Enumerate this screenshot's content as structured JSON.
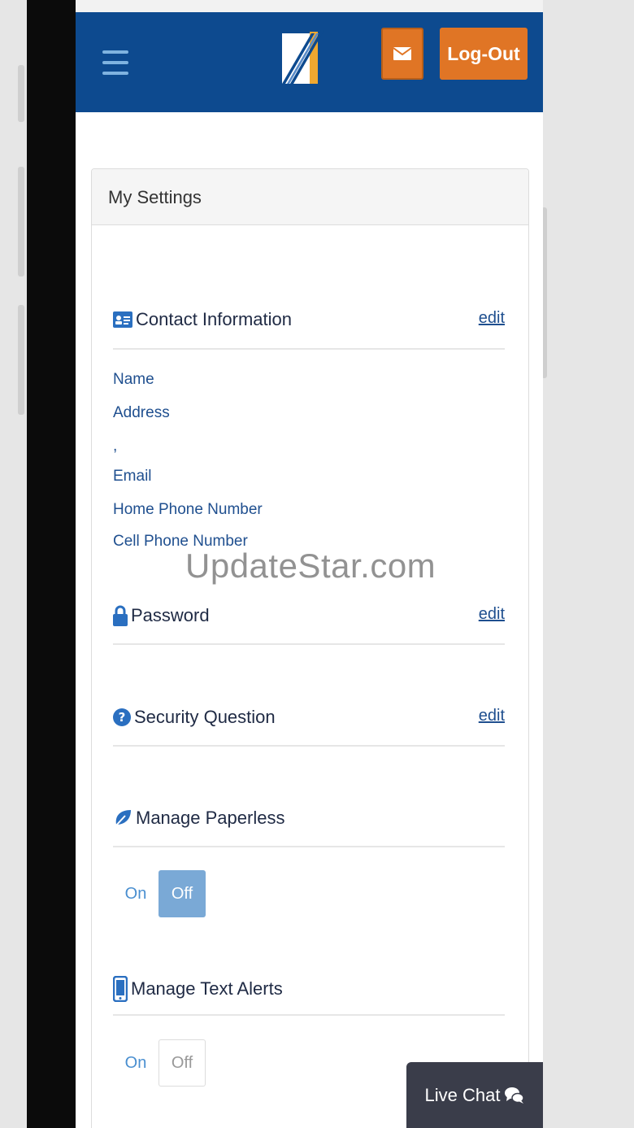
{
  "header": {
    "menu_icon": "hamburger-icon",
    "mail_icon": "envelope-icon",
    "logout_label": "Log-Out",
    "colors": {
      "header": "#0d4a8f",
      "accent": "#e07525",
      "text_link": "#1f4f8f"
    }
  },
  "settings": {
    "title": "My Settings",
    "contact": {
      "icon": "id-card-icon",
      "title": "Contact Information",
      "edit_label": "edit",
      "fields": [
        "Name",
        "Address",
        ",",
        "Email",
        "Home Phone Number",
        "Cell Phone Number"
      ]
    },
    "password": {
      "icon": "lock-icon",
      "title": "Password",
      "edit_label": "edit"
    },
    "security": {
      "icon": "question-circle-icon",
      "title": "Security Question",
      "edit_label": "edit"
    },
    "paperless": {
      "icon": "leaf-icon",
      "title": "Manage Paperless",
      "on_label": "On",
      "off_label": "Off",
      "state": "Off"
    },
    "text_alerts": {
      "icon": "mobile-phone-icon",
      "title": "Manage Text Alerts",
      "on_label": "On",
      "off_label": "Off"
    }
  },
  "watermark": "UpdateStar.com",
  "live_chat": {
    "label": "Live Chat",
    "icon": "chat-bubbles-icon"
  }
}
